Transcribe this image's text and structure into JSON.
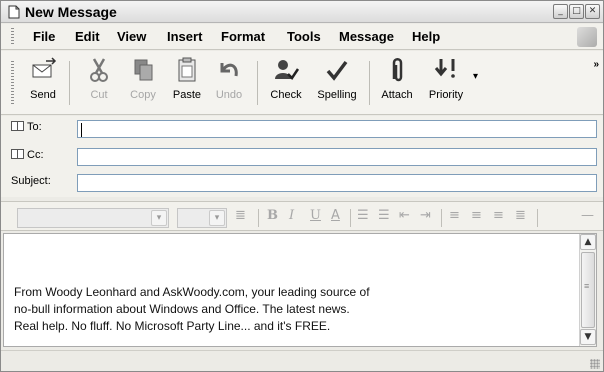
{
  "window": {
    "title": "New Message"
  },
  "menu": [
    "File",
    "Edit",
    "View",
    "Insert",
    "Format",
    "Tools",
    "Message",
    "Help"
  ],
  "toolbar": {
    "send": "Send",
    "cut": "Cut",
    "copy": "Copy",
    "paste": "Paste",
    "undo": "Undo",
    "check": "Check",
    "spelling": "Spelling",
    "attach": "Attach",
    "priority": "Priority"
  },
  "fields": {
    "to_label": "To:",
    "to_value": "",
    "cc_label": "Cc:",
    "cc_value": "",
    "subject_label": "Subject:",
    "subject_value": ""
  },
  "format": {
    "font": "",
    "size": ""
  },
  "body": {
    "line1": "From Woody Leonhard and AskWoody.com, your leading source of",
    "line2": "no-bull information about Windows and Office. The latest news.",
    "line3": "Real help. No fluff. No Microsoft Party Line... and it's FREE."
  },
  "colors": {
    "chrome": "#ecebe6",
    "border": "#7f9db9",
    "disabled_text": "#a6a6a6"
  }
}
